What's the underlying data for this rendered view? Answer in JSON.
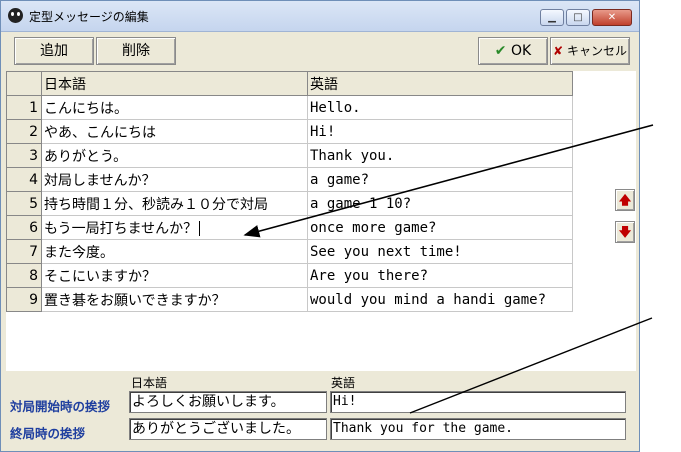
{
  "window": {
    "title": "定型メッセージの編集"
  },
  "toolbar": {
    "add_label": "追加",
    "delete_label": "削除",
    "ok_label": "OK",
    "cancel_label": "キャンセル"
  },
  "grid": {
    "headers": {
      "ja": "日本語",
      "en": "英語"
    },
    "rows": [
      {
        "num": "1",
        "ja": "こんにちは。",
        "en": "Hello."
      },
      {
        "num": "2",
        "ja": "やあ、こんにちは",
        "en": "Hi!"
      },
      {
        "num": "3",
        "ja": "ありがとう。",
        "en": "Thank you."
      },
      {
        "num": "4",
        "ja": "対局しませんか？",
        "en": "a game?"
      },
      {
        "num": "5",
        "ja": "持ち時間１分、秒読み１０分で対局",
        "en": "a game 1 10?"
      },
      {
        "num": "6",
        "ja": "もう一局打ちませんか？",
        "en": "once more game?"
      },
      {
        "num": "7",
        "ja": "また今度。",
        "en": "See you next time!"
      },
      {
        "num": "8",
        "ja": "そこにいますか？",
        "en": "Are you there?"
      },
      {
        "num": "9",
        "ja": "置き碁をお願いできますか？",
        "en": "would you mind a handi game?"
      }
    ]
  },
  "greetings": {
    "col_ja": "日本語",
    "col_en": "英語",
    "start": {
      "label": "対局開始時の挨拶",
      "ja": "よろしくお願いします。",
      "en": "Hi!"
    },
    "end": {
      "label": "終局時の挨拶",
      "ja": "ありがとうございました。",
      "en": "Thank you for the game."
    }
  }
}
